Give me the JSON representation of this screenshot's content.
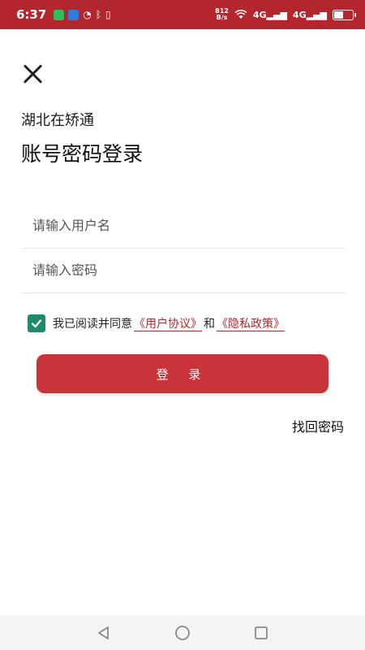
{
  "status_bar": {
    "time": "6:37",
    "net_speed_value": "812",
    "net_speed_unit": "B/s",
    "signal1": "4G",
    "signal2": "4G",
    "battery_level": 0.5,
    "color": "#b3262e"
  },
  "header": {
    "app_name": "湖北在矫通",
    "title": "账号密码登录"
  },
  "form": {
    "username_placeholder": "请输入用户名",
    "password_placeholder": "请输入密码",
    "username_value": "",
    "password_value": ""
  },
  "agreement": {
    "checked": true,
    "prefix": "我已阅读并同意",
    "user_agreement": "《用户协议》",
    "conjunction": "和",
    "privacy_policy": "《隐私政策》"
  },
  "actions": {
    "login_label": "登 录",
    "forgot_label": "找回密码"
  },
  "colors": {
    "accent": "#c9343b",
    "checkbox": "#1f8a6e"
  },
  "icons": {
    "close": "close-icon",
    "check": "check-icon",
    "nav_back": "triangle-back-icon",
    "nav_home": "circle-home-icon",
    "nav_recent": "square-recent-icon"
  }
}
